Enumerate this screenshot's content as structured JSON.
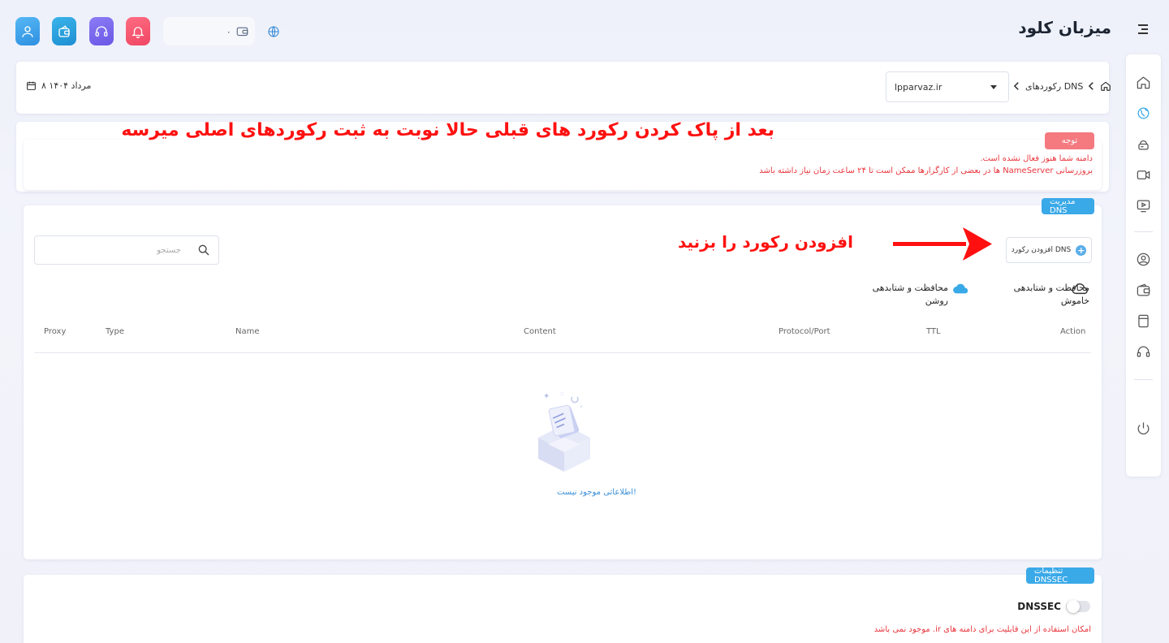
{
  "header": {
    "logo": "میزبان کلود",
    "balance": "۰",
    "icons": [
      "user-icon",
      "wallet-icon",
      "headset-icon",
      "bell-icon",
      "globe-icon",
      "menu-icon"
    ]
  },
  "breadcrumb": {
    "date": "۸ مرداد ۱۴۰۴",
    "current": "رکوردهای DNS",
    "domain_select": "lpparvaz.ir"
  },
  "notice": {
    "badge": "توجه",
    "line1": "دامنه شما هنوز فعال نشده است.",
    "line2": "بروزرسانی NameServer ها در بعضی از کارگزارها ممکن است تا ۲۴ ساعت زمان نیاز داشته باشد"
  },
  "dns": {
    "badge": "مدیریت DNS",
    "add_button": "افزودن رکورد DNS",
    "search_placeholder": "جستجو",
    "legend_off": {
      "line1": "محافظت و شتابدهی",
      "line2": "خاموش"
    },
    "legend_on": {
      "line1": "محافظت و شتابدهی",
      "line2": "روشن"
    },
    "columns": [
      "Proxy",
      "Type",
      "Name",
      "Content",
      "Protocol/Port",
      "TTL",
      "Action"
    ],
    "rows": [],
    "empty_text": "اطلاعاتی موجود نیست!"
  },
  "dnssec": {
    "badge": "تنظیمات DNSSEC",
    "label": "DNSSEC",
    "enabled": false,
    "note": "امکان استفاده از این قابلیت برای دامنه های ir. موجود نمی باشد"
  },
  "annotations": {
    "top": "بعد از پاک کردن رکورد های قبلی حالا نوبت به ثبت رکوردهای اصلی میرسه",
    "arrow_note": "افزودن رکورد را بزنید"
  },
  "colors": {
    "accent": "#3aa9e8",
    "danger": "#e8363d",
    "annotation": "#ff1010"
  }
}
